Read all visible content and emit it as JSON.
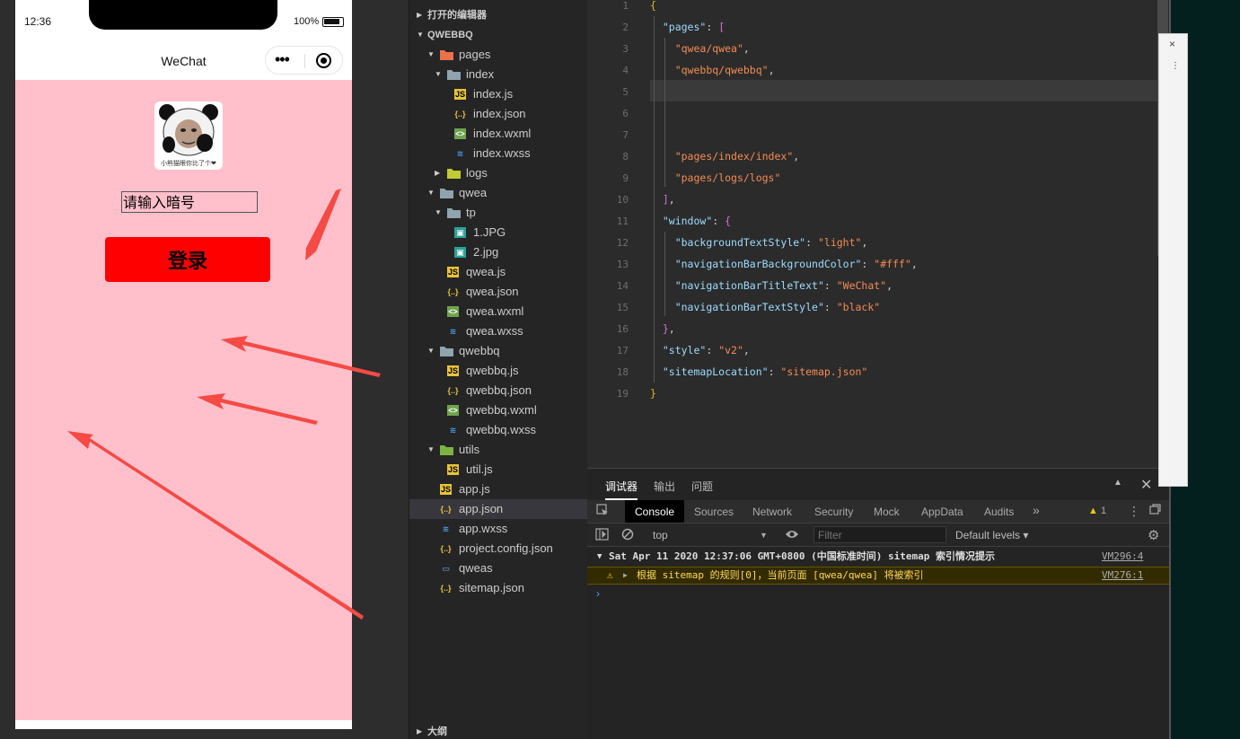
{
  "simulator": {
    "status": {
      "time": "12:36",
      "battery": "100%"
    },
    "nav": {
      "title": "WeChat",
      "more_icon": "•••"
    },
    "avatar": {
      "caption": "小熊猫眼你比了个❤"
    },
    "input": {
      "placeholder": "请输入暗号"
    },
    "button": {
      "label": "登录"
    }
  },
  "explorer": {
    "open_editors": "打开的编辑器",
    "project": "QWEBBQ",
    "outline": "大纲",
    "tree": [
      {
        "name": "pages",
        "depth": 1,
        "kind": "folder-open",
        "color": "#e8734a"
      },
      {
        "name": "index",
        "depth": 2,
        "kind": "folder-open",
        "color": "#90a4ae"
      },
      {
        "name": "index.js",
        "depth": 3,
        "kind": "js"
      },
      {
        "name": "index.json",
        "depth": 3,
        "kind": "json"
      },
      {
        "name": "index.wxml",
        "depth": 3,
        "kind": "wxml"
      },
      {
        "name": "index.wxss",
        "depth": 3,
        "kind": "wxss"
      },
      {
        "name": "logs",
        "depth": 2,
        "kind": "folder-closed",
        "color": "#c0ca33"
      },
      {
        "name": "qwea",
        "depth": 1,
        "kind": "folder-open",
        "color": "#90a4ae"
      },
      {
        "name": "tp",
        "depth": 2,
        "kind": "folder-open",
        "color": "#90a4ae"
      },
      {
        "name": "1.JPG",
        "depth": 3,
        "kind": "img"
      },
      {
        "name": "2.jpg",
        "depth": 3,
        "kind": "img"
      },
      {
        "name": "qwea.js",
        "depth": 2,
        "kind": "js"
      },
      {
        "name": "qwea.json",
        "depth": 2,
        "kind": "json"
      },
      {
        "name": "qwea.wxml",
        "depth": 2,
        "kind": "wxml"
      },
      {
        "name": "qwea.wxss",
        "depth": 2,
        "kind": "wxss"
      },
      {
        "name": "qwebbq",
        "depth": 1,
        "kind": "folder-open",
        "color": "#90a4ae"
      },
      {
        "name": "qwebbq.js",
        "depth": 2,
        "kind": "js"
      },
      {
        "name": "qwebbq.json",
        "depth": 2,
        "kind": "json"
      },
      {
        "name": "qwebbq.wxml",
        "depth": 2,
        "kind": "wxml"
      },
      {
        "name": "qwebbq.wxss",
        "depth": 2,
        "kind": "wxss"
      },
      {
        "name": "utils",
        "depth": 1,
        "kind": "folder-open",
        "color": "#7cb342"
      },
      {
        "name": "util.js",
        "depth": 2,
        "kind": "js"
      },
      {
        "name": "app.js",
        "depth": 1,
        "kind": "js"
      },
      {
        "name": "app.json",
        "depth": 1,
        "kind": "json",
        "selected": true
      },
      {
        "name": "app.wxss",
        "depth": 1,
        "kind": "wxss"
      },
      {
        "name": "project.config.json",
        "depth": 1,
        "kind": "json"
      },
      {
        "name": "qweas",
        "depth": 1,
        "kind": "file"
      },
      {
        "name": "sitemap.json",
        "depth": 1,
        "kind": "json"
      }
    ]
  },
  "editor": {
    "lines": [
      {
        "n": "1",
        "tokens": [
          [
            "{",
            "#e6b422"
          ]
        ]
      },
      {
        "n": "2",
        "tokens": [
          [
            "  ",
            ""
          ],
          [
            "\"pages\"",
            "#9cdcfe"
          ],
          [
            ": ",
            "#ccc"
          ],
          [
            "[",
            "#d670d6"
          ]
        ]
      },
      {
        "n": "3",
        "tokens": [
          [
            "    ",
            ""
          ],
          [
            "\"qwea/qwea\"",
            "#f28b54"
          ],
          [
            ",",
            "#ccc"
          ]
        ]
      },
      {
        "n": "4",
        "tokens": [
          [
            "    ",
            ""
          ],
          [
            "\"qwebbq/qwebbq\"",
            "#f28b54"
          ],
          [
            ",",
            "#ccc"
          ]
        ]
      },
      {
        "n": "5",
        "tokens": []
      },
      {
        "n": "6",
        "tokens": []
      },
      {
        "n": "7",
        "tokens": []
      },
      {
        "n": "8",
        "tokens": [
          [
            "    ",
            ""
          ],
          [
            "\"pages/index/index\"",
            "#f28b54"
          ],
          [
            ",",
            "#ccc"
          ]
        ]
      },
      {
        "n": "9",
        "tokens": [
          [
            "    ",
            ""
          ],
          [
            "\"pages/logs/logs\"",
            "#f28b54"
          ]
        ]
      },
      {
        "n": "10",
        "tokens": [
          [
            "  ",
            ""
          ],
          [
            "]",
            "#d670d6"
          ],
          [
            ",",
            "#ccc"
          ]
        ]
      },
      {
        "n": "11",
        "tokens": [
          [
            "  ",
            ""
          ],
          [
            "\"window\"",
            "#9cdcfe"
          ],
          [
            ": ",
            "#ccc"
          ],
          [
            "{",
            "#d670d6"
          ]
        ]
      },
      {
        "n": "12",
        "tokens": [
          [
            "    ",
            ""
          ],
          [
            "\"backgroundTextStyle\"",
            "#9cdcfe"
          ],
          [
            ": ",
            "#ccc"
          ],
          [
            "\"light\"",
            "#f28b54"
          ],
          [
            ",",
            "#ccc"
          ]
        ]
      },
      {
        "n": "13",
        "tokens": [
          [
            "    ",
            ""
          ],
          [
            "\"navigationBarBackgroundColor\"",
            "#9cdcfe"
          ],
          [
            ": ",
            "#ccc"
          ],
          [
            "\"#fff\"",
            "#f28b54"
          ],
          [
            ",",
            "#ccc"
          ]
        ]
      },
      {
        "n": "14",
        "tokens": [
          [
            "    ",
            ""
          ],
          [
            "\"navigationBarTitleText\"",
            "#9cdcfe"
          ],
          [
            ": ",
            "#ccc"
          ],
          [
            "\"WeChat\"",
            "#f28b54"
          ],
          [
            ",",
            "#ccc"
          ]
        ]
      },
      {
        "n": "15",
        "tokens": [
          [
            "    ",
            ""
          ],
          [
            "\"navigationBarTextStyle\"",
            "#9cdcfe"
          ],
          [
            ": ",
            "#ccc"
          ],
          [
            "\"black\"",
            "#f28b54"
          ]
        ]
      },
      {
        "n": "16",
        "tokens": [
          [
            "  ",
            ""
          ],
          [
            "}",
            "#d670d6"
          ],
          [
            ",",
            "#ccc"
          ]
        ]
      },
      {
        "n": "17",
        "tokens": [
          [
            "  ",
            ""
          ],
          [
            "\"style\"",
            "#9cdcfe"
          ],
          [
            ": ",
            "#ccc"
          ],
          [
            "\"v2\"",
            "#f28b54"
          ],
          [
            ",",
            "#ccc"
          ]
        ]
      },
      {
        "n": "18",
        "tokens": [
          [
            "  ",
            ""
          ],
          [
            "\"sitemapLocation\"",
            "#9cdcfe"
          ],
          [
            ": ",
            "#ccc"
          ],
          [
            "\"sitemap.json\"",
            "#f28b54"
          ]
        ]
      },
      {
        "n": "19",
        "tokens": [
          [
            "}",
            "#e6b422"
          ]
        ]
      }
    ]
  },
  "devtools": {
    "tabs": [
      "调试器",
      "输出",
      "问题"
    ],
    "inner_tabs": [
      "Console",
      "Sources",
      "Network",
      "Security",
      "Mock",
      "AppData",
      "Audits",
      "»"
    ],
    "warning_count": "1",
    "context": "top",
    "filter_placeholder": "Filter",
    "levels": "Default levels ▾",
    "messages": [
      {
        "text": "Sat Apr 11 2020 12:37:06 GMT+0800 (中国标准时间) sitemap 索引情况提示",
        "link": "VM296:4"
      },
      {
        "text": "根据 sitemap 的规则[0]，当前页面 [qwea/qwea] 将被索引",
        "link": "VM276:1"
      }
    ],
    "prompt": "›"
  },
  "right_panel": {
    "close": "×",
    "more": "⋮"
  }
}
